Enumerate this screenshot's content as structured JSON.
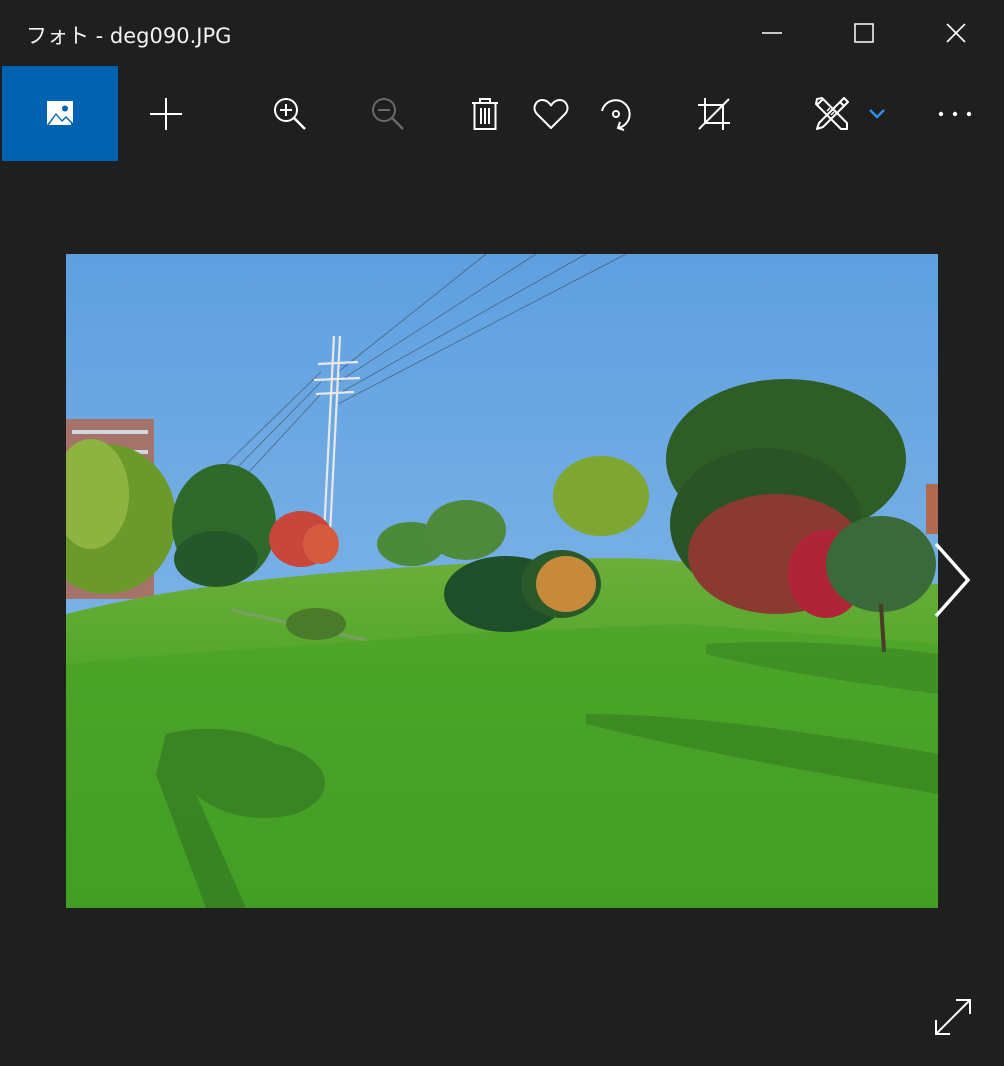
{
  "window": {
    "title": "フォト - deg090.JPG",
    "controls": [
      "minimize-icon",
      "maximize-icon",
      "close-icon"
    ]
  },
  "toolbar": {
    "items": [
      {
        "icon": "picture-icon",
        "active": true
      },
      {
        "icon": "add-icon"
      },
      {
        "icon": "zoom-in-icon"
      },
      {
        "icon": "zoom-out-icon",
        "enabled": false
      },
      {
        "icon": "delete-icon"
      },
      {
        "icon": "favorite-icon"
      },
      {
        "icon": "rotate-icon"
      },
      {
        "icon": "crop-icon"
      },
      {
        "icon": "edit-draw-icon"
      },
      {
        "icon": "chevron-down-icon"
      },
      {
        "icon": "more-icon"
      }
    ]
  },
  "colors": {
    "background": "#1f1f1f",
    "accent": "#0063b1",
    "accent_chevron": "#2f8fe6",
    "disabled_icon": "#6a6a6a"
  },
  "photo": {
    "description_icon": "landscape-photo"
  },
  "navigation": {
    "next_icon": "chevron-right-icon",
    "fullscreen_icon": "expand-icon"
  }
}
